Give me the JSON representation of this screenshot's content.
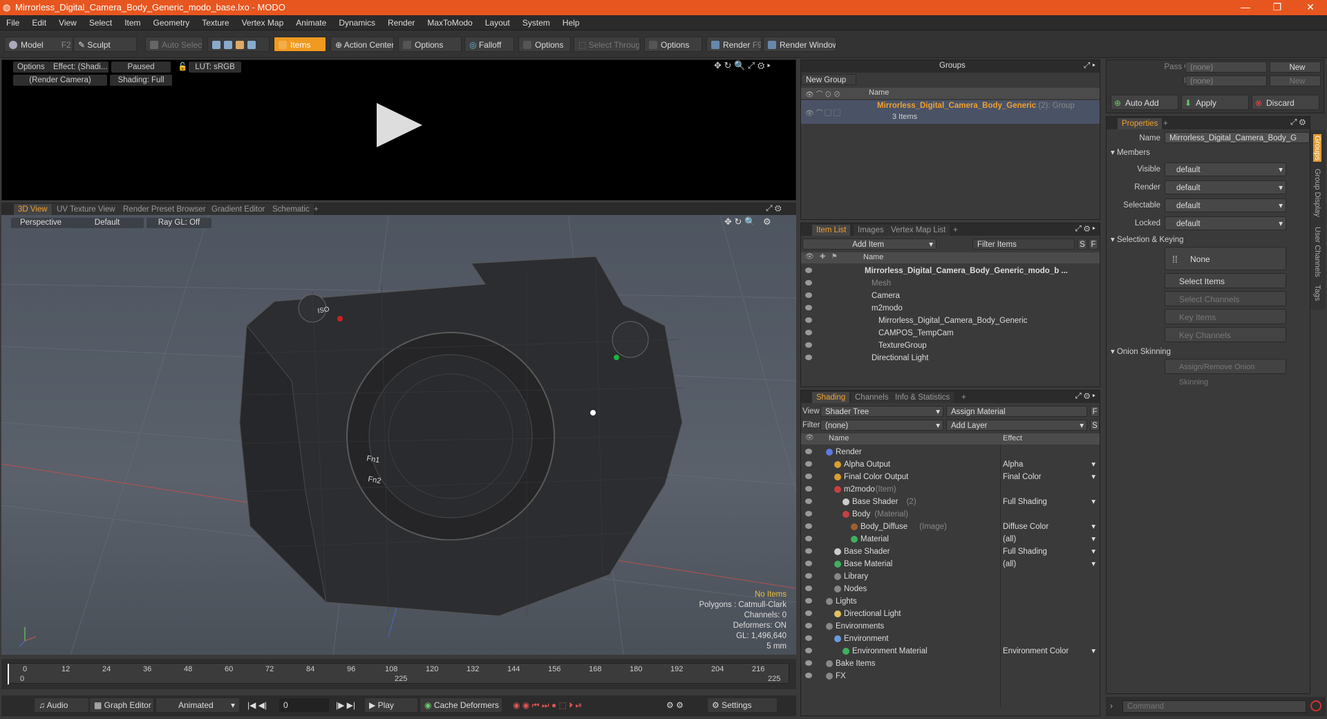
{
  "window": {
    "title": "Mirrorless_Digital_Camera_Body_Generic_modo_base.lxo - MODO",
    "controls": [
      "—",
      "❐",
      "✕"
    ]
  },
  "menu": [
    "File",
    "Edit",
    "View",
    "Select",
    "Item",
    "Geometry",
    "Texture",
    "Vertex Map",
    "Animate",
    "Dynamics",
    "Render",
    "MaxToModo",
    "Layout",
    "System",
    "Help"
  ],
  "toolbar": {
    "model": "Model",
    "model_key": "F2",
    "sculpt": "Sculpt",
    "auto_select": "Auto Select",
    "items": "Items",
    "action_center": "Action Center",
    "options1": "Options",
    "falloff": "Falloff",
    "options2": "Options",
    "select_through": "Select Through",
    "options3": "Options",
    "render": "Render",
    "render_key": "F9",
    "render_window": "Render Window"
  },
  "preview": {
    "options": "Options",
    "effect": "Effect: (Shadi...",
    "paused": "Paused",
    "lut": "LUT: sRGB",
    "camera": "(Render Camera)",
    "shading": "Shading: Full"
  },
  "view_tabs": [
    "3D View",
    "UV Texture View",
    "Render Preset Browser",
    "Gradient Editor",
    "Schematic",
    "+"
  ],
  "viewport": {
    "projection": "Perspective",
    "style": "Default",
    "raygl": "Ray GL: Off",
    "stats": {
      "no_items": "No Items",
      "polygons": "Polygons : Catmull-Clark",
      "channels": "Channels: 0",
      "deformers": "Deformers: ON",
      "gl": "GL: 1,496,640",
      "unit": "5 mm"
    },
    "labels": [
      "Fn1",
      "Fn2",
      "ISO"
    ]
  },
  "timeline": {
    "ticks": [
      "0",
      "12",
      "24",
      "36",
      "48",
      "60",
      "72",
      "84",
      "96",
      "108",
      "120",
      "132",
      "144",
      "156",
      "168",
      "180",
      "192",
      "204",
      "216"
    ],
    "start": "0",
    "mid": "225",
    "end": "225"
  },
  "transport": {
    "audio": "Audio",
    "graph_editor": "Graph Editor",
    "animated": "Animated",
    "frame": "0",
    "play": "Play",
    "cache": "Cache Deformers",
    "settings": "Settings"
  },
  "groups": {
    "title": "Groups",
    "new_group": "New Group",
    "col_name": "Name",
    "item_name": "Mirrorless_Digital_Camera_Body_Generic",
    "item_count": "(2)",
    "item_type": ": Group",
    "item_sub": "3 Items"
  },
  "itemlist": {
    "tabs": [
      "Item List",
      "Images",
      "Vertex Map List",
      "+"
    ],
    "add_item": "Add Item",
    "filter": "Filter Items",
    "s": "S",
    "f": "F",
    "col_name": "Name",
    "rows": [
      {
        "label": "Mirrorless_Digital_Camera_Body_Generic_modo_b ...",
        "indent": 0,
        "bold": true
      },
      {
        "label": "Mesh",
        "indent": 1,
        "gray": true
      },
      {
        "label": "Camera",
        "indent": 1
      },
      {
        "label": "m2modo",
        "indent": 1
      },
      {
        "label": "Mirrorless_Digital_Camera_Body_Generic",
        "indent": 2
      },
      {
        "label": "CAMPOS_TempCam",
        "indent": 2
      },
      {
        "label": "TextureGroup",
        "indent": 2
      },
      {
        "label": "Directional Light",
        "indent": 1
      }
    ]
  },
  "shading": {
    "tabs": [
      "Shading",
      "Channels",
      "Info & Statistics",
      "+"
    ],
    "view_label": "View",
    "view_value": "Shader Tree",
    "assign": "Assign Material",
    "f": "F",
    "filter_label": "Filter",
    "filter_value": "(none)",
    "add_layer": "Add Layer",
    "s": "S",
    "col_name": "Name",
    "col_effect": "Effect",
    "rows": [
      {
        "name": "Render",
        "extra": "",
        "effect": "",
        "indent": 0
      },
      {
        "name": "Alpha Output",
        "extra": "",
        "effect": "Alpha",
        "indent": 1
      },
      {
        "name": "Final Color Output",
        "extra": "",
        "effect": "Final Color",
        "indent": 1
      },
      {
        "name": "m2modo",
        "extra": "(Item)",
        "effect": "",
        "indent": 1
      },
      {
        "name": "Base Shader",
        "extra": "(2)",
        "effect": "Full Shading",
        "indent": 2
      },
      {
        "name": "Body",
        "extra": "(Material)",
        "effect": "",
        "indent": 2
      },
      {
        "name": "Body_Diffuse",
        "extra": "(Image)",
        "effect": "Diffuse Color",
        "indent": 3
      },
      {
        "name": "Material",
        "extra": "",
        "effect": "(all)",
        "indent": 3
      },
      {
        "name": "Base Shader",
        "extra": "",
        "effect": "Full Shading",
        "indent": 1
      },
      {
        "name": "Base Material",
        "extra": "",
        "effect": "(all)",
        "indent": 1
      },
      {
        "name": "Library",
        "extra": "",
        "effect": "",
        "indent": 1
      },
      {
        "name": "Nodes",
        "extra": "",
        "effect": "",
        "indent": 1
      },
      {
        "name": "Lights",
        "extra": "",
        "effect": "",
        "indent": 0
      },
      {
        "name": "Directional Light",
        "extra": "",
        "effect": "",
        "indent": 1
      },
      {
        "name": "Environments",
        "extra": "",
        "effect": "",
        "indent": 0
      },
      {
        "name": "Environment",
        "extra": "",
        "effect": "",
        "indent": 1
      },
      {
        "name": "Environment Material",
        "extra": "",
        "effect": "Environment Color",
        "indent": 2
      },
      {
        "name": "Bake Items",
        "extra": "",
        "effect": "",
        "indent": 0
      },
      {
        "name": "FX",
        "extra": "",
        "effect": "",
        "indent": 0
      }
    ]
  },
  "passes": {
    "pass_groups": "Pass Groups",
    "passes": "Passes",
    "none": "(none)",
    "new": "New",
    "auto_add": "Auto Add",
    "apply": "Apply",
    "discard": "Discard"
  },
  "properties": {
    "tab": "Properties",
    "plus": "+",
    "name_label": "Name",
    "name_value": "Mirrorless_Digital_Camera_Body_G",
    "members": "Members",
    "fields": [
      {
        "label": "Visible",
        "value": "default"
      },
      {
        "label": "Render",
        "value": "default"
      },
      {
        "label": "Selectable",
        "value": "default"
      },
      {
        "label": "Locked",
        "value": "default"
      }
    ],
    "sel_keying": "Selection & Keying",
    "none": "None",
    "select_items": "Select Items",
    "select_channels": "Select Channels",
    "key_items": "Key Items",
    "key_channels": "Key Channels",
    "onion": "Onion Skinning",
    "assign_onion": "Assign/Remove Onion Skinning"
  },
  "side_tabs": [
    "Groups",
    "Group Display",
    "User Channels",
    "Tags"
  ],
  "command": {
    "placeholder": "Command"
  }
}
